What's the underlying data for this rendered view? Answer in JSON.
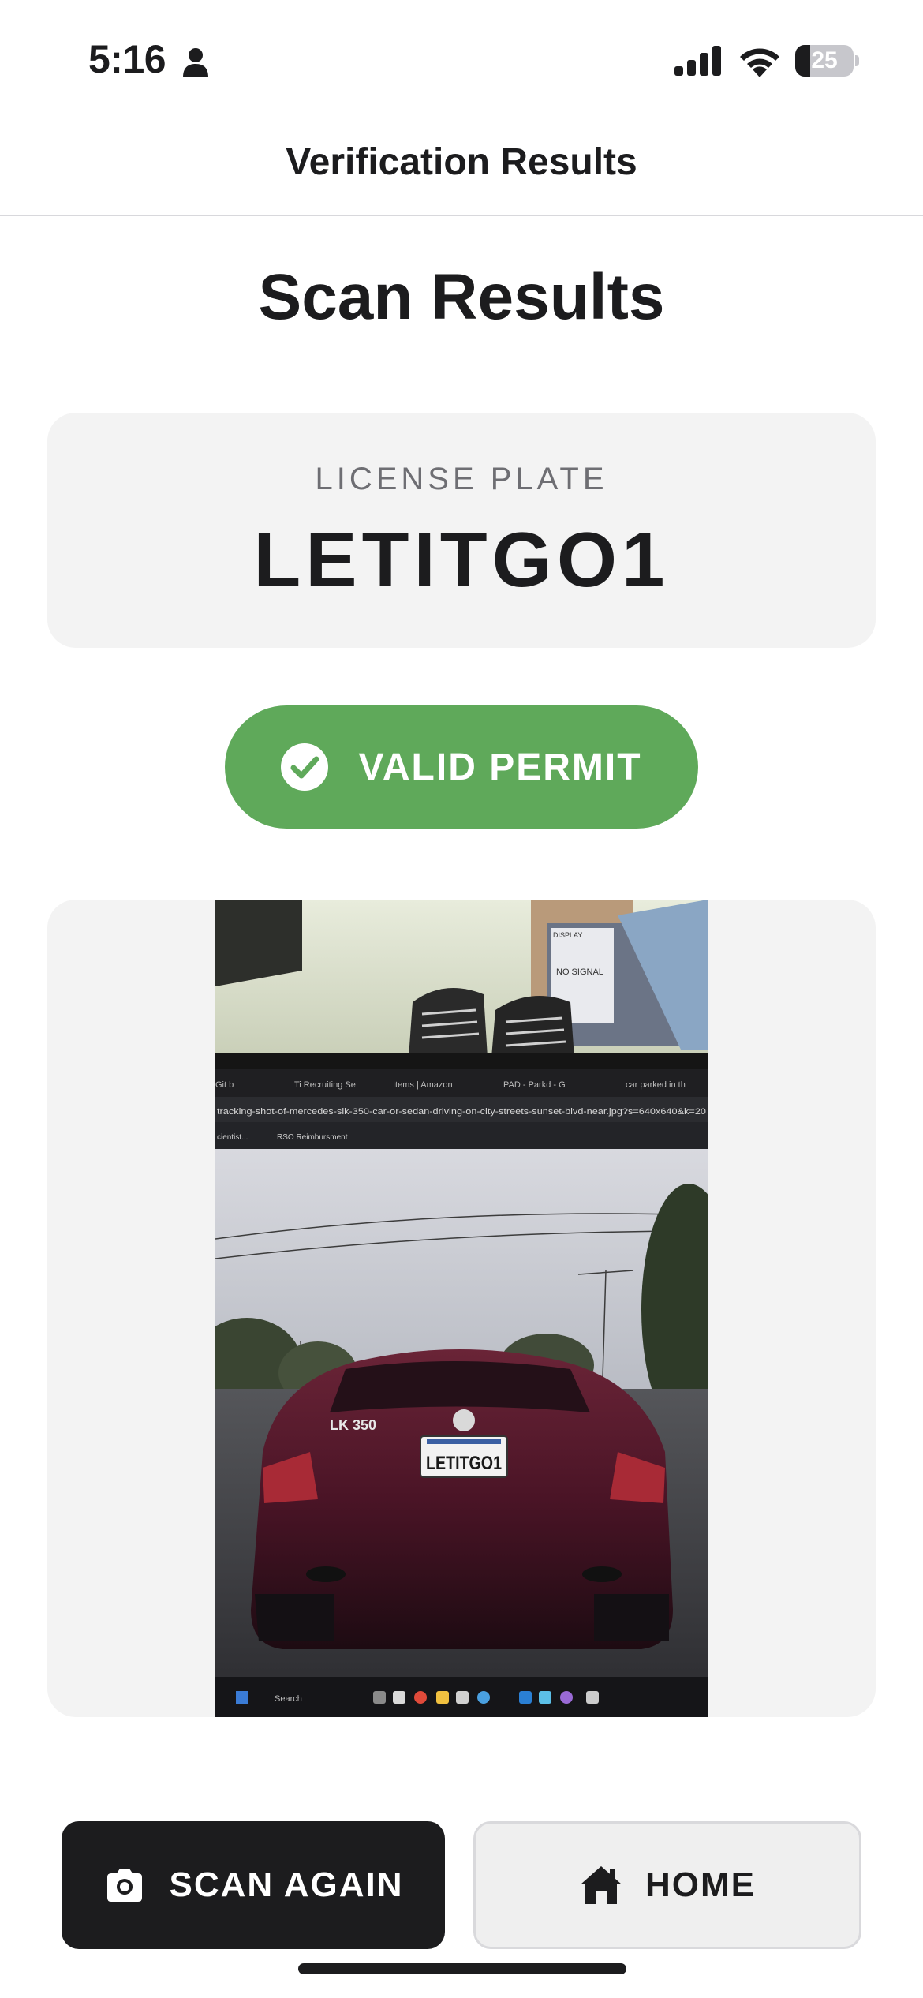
{
  "status_bar": {
    "time": "5:16",
    "battery_level": "25",
    "battery_fraction": 0.25,
    "icons": [
      "person-icon",
      "cellular-signal-icon",
      "wifi-icon",
      "battery-icon"
    ]
  },
  "nav": {
    "title": "Verification Results"
  },
  "main": {
    "heading": "Scan Results",
    "plate": {
      "label": "LICENSE PLATE",
      "number": "LETITGO1"
    },
    "permit": {
      "status": "VALID PERMIT",
      "icon": "checkmark-circle-icon",
      "color": "#5fa95a"
    },
    "photo": {
      "plate_text": "LETITGO1",
      "badge_text": "LK 350",
      "tab_labels": [
        "Git b",
        "Ti Recruiting Se",
        "Items | Amazon",
        "PAD - Parkd - G",
        "car parked in th"
      ],
      "url_text": "tracking-shot-of-mercedes-slk-350-car-or-sedan-driving-on-city-streets-sunset-blvd-near.jpg?s=640x640&k=20",
      "bookmark_text": "RSO Reimbursment",
      "bookmark_prefix": "cientist...",
      "taskbar_search": "Search",
      "tv_text": "NO SIGNAL",
      "tv_label": "DISPLAY"
    }
  },
  "actions": {
    "scan_again": {
      "label": "SCAN AGAIN",
      "icon": "camera-icon"
    },
    "home": {
      "label": "HOME",
      "icon": "home-icon"
    }
  },
  "colors": {
    "accent_green": "#5fa95a",
    "primary_dark": "#1c1c1e",
    "card_bg": "#f3f3f3"
  }
}
